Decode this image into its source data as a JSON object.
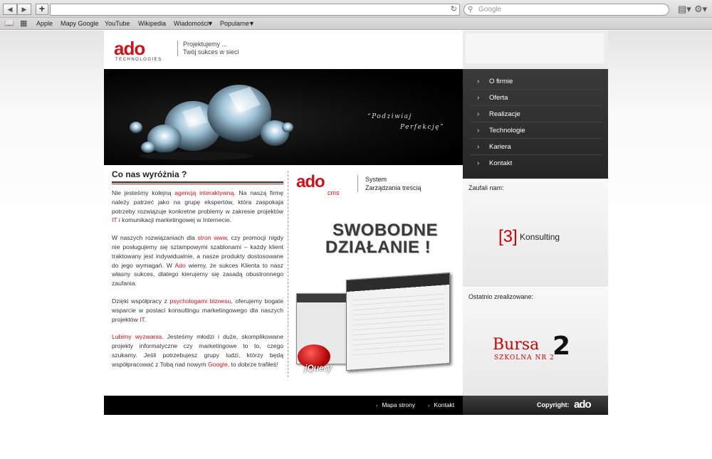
{
  "browser": {
    "search_placeholder": "Google",
    "bookmarks": [
      "Apple",
      "Mapy Google",
      "YouTube",
      "Wikipedia",
      "Wiadomości",
      "Popularne"
    ]
  },
  "header": {
    "logo": "ado",
    "logo_sub": "TECHNOLOGIES",
    "tagline_1": "Projektujemy ...",
    "tagline_2": "Twój sukces w sieci"
  },
  "banner": {
    "quote_1": "“Podziwiaj",
    "quote_2": "Perfekcję”"
  },
  "nav": {
    "items": [
      "O firmie",
      "Oferta",
      "Realizacje",
      "Technologie",
      "Kariera",
      "Kontakt"
    ]
  },
  "content": {
    "title": "Co nas wyróżnia ?",
    "p1a": "Nie jesteśmy kolejną ",
    "p1_link": "agencją interaktywną",
    "p1b": ". Na naszą firmę należy patrzeć jako na grupę ekspertów, która zaspokaja potrzeby rozwiązuje konkretne problemy w zakresie projektów ",
    "p1_it": "IT",
    "p1c": " i komunikacji marketingowej w Internecie.",
    "p2a": "W naszych rozwiązaniach dla ",
    "p2_link": "stron www",
    "p2b": ", czy promocji nigdy nie posługujemy się sztampowymi szablonami – każdy klient traktowany jest indywidualnie, a nasze produkty dostosowane do jego wymagań. W ",
    "p2_ado": "Ado",
    "p2c": " wiemy, że sukces Klienta to nasz własny sukces, dlatego kierujemy się zasadą obustronnego zaufania.",
    "p3a": "Dzięki współpracy z ",
    "p3_link": "psychologami biznesu",
    "p3b": ", oferujemy bogate wsparcie w postaci konsultingu marketingowego dla naszych projektów ",
    "p3_it": "IT",
    "p3c": ".",
    "p4_link": "Lubimy wyzwania",
    "p4a": ". Jesteśmy młodzi i duże, skomplikowane projekty informatyczne czy marketingowe to to, czego szukamy. Jeśli potrzebujesz grupy ludzi, którzy będą współpracować z Tobą nad nowym ",
    "p4_google": "Google",
    "p4b": ", to dobrze trafiłeś!"
  },
  "cms": {
    "logo": "ado",
    "logo_sub": "cms",
    "system_1": "System",
    "system_2": "Zarządzania treścią",
    "slogan_1": "SWOBODNE",
    "slogan_2": "DZIAŁANIE !",
    "jquery": "jQuery"
  },
  "side": {
    "trusted_title": "Zaufali nam:",
    "konsulting_num": "[3]",
    "konsulting_name": "Konsulting",
    "recent_title": "Ostatnio zrealizowane:",
    "bursa_main": "Bursa",
    "bursa_sub": "SZKOLNA NR 2",
    "bursa_num": "2"
  },
  "footer": {
    "link_1": "Mapa strony",
    "link_2": "Kontakt",
    "copyright": "Copyright:",
    "copy_logo": "ado"
  },
  "colors": {
    "brand_red": "#d0121b",
    "nav_bg": "#2e2e2e"
  }
}
